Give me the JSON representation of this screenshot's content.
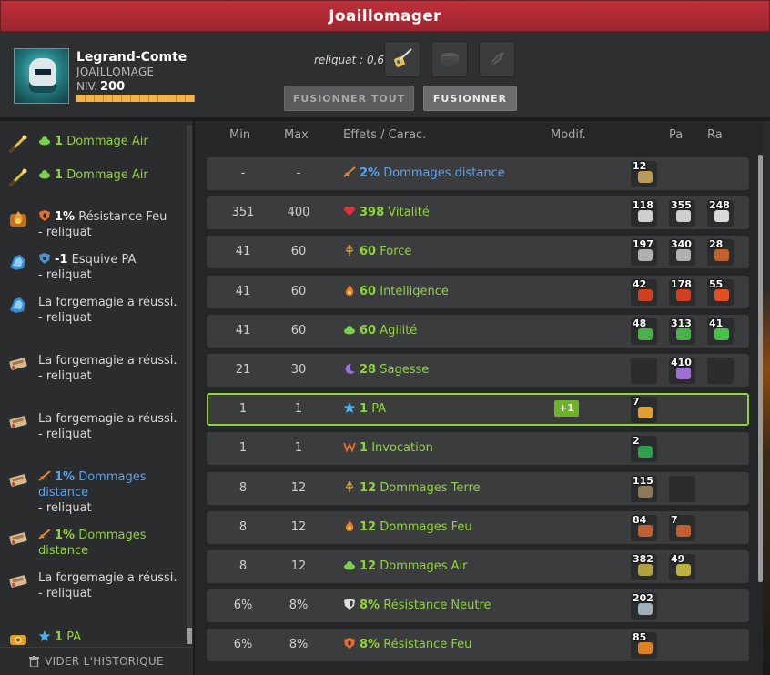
{
  "window": {
    "title": "Joaillomager"
  },
  "character": {
    "name": "Legrand-Comte",
    "job": "JOAILLOMAGE",
    "level_label": "NIV.",
    "level": "200",
    "avatar": "knight-avatar"
  },
  "reliquat": "reliquat : 0,6",
  "slots": [
    {
      "name": "rune-slot-icon",
      "filled": true
    },
    {
      "name": "item-slot-icon",
      "filled": false
    },
    {
      "name": "feather-slot-icon",
      "filled": false
    }
  ],
  "buttons": {
    "merge_all": "FUSIONNER TOUT",
    "merge": "FUSIONNER"
  },
  "history": [
    {
      "icon": "wand-icon",
      "stat_icon": "air-icon",
      "value": "1",
      "label": "Dommage Air",
      "color": "green",
      "sub": ""
    },
    {
      "icon": "wand-icon",
      "stat_icon": "air-icon",
      "value": "1",
      "label": "Dommage Air",
      "color": "green",
      "sub": ""
    },
    {
      "icon": "fire-rune-icon",
      "stat_icon": "shield-fire-icon",
      "value": "1%",
      "label": "Résistance Feu",
      "color": "white",
      "sub": "- reliquat"
    },
    {
      "icon": "blue-rune-icon",
      "stat_icon": "shield-blue-icon",
      "value": "-1",
      "label": "Esquive PA",
      "color": "white",
      "sub": "- reliquat"
    },
    {
      "icon": "blue-rune-icon",
      "stat_icon": "",
      "value": "",
      "label": "La forgemagie a réussi.",
      "color": "white",
      "sub": "- reliquat"
    },
    {
      "icon": "scroll-rune-icon",
      "stat_icon": "",
      "value": "",
      "label": "La forgemagie a réussi.",
      "color": "white",
      "sub": "- reliquat"
    },
    {
      "icon": "scroll-rune-icon",
      "stat_icon": "",
      "value": "",
      "label": "La forgemagie a réussi.",
      "color": "white",
      "sub": "- reliquat"
    },
    {
      "icon": "scroll-rune-icon",
      "stat_icon": "sword-icon",
      "value": "1%",
      "label": "Dommages distance",
      "color": "blue",
      "sub": "- reliquat"
    },
    {
      "icon": "scroll-rune-icon",
      "stat_icon": "sword-icon",
      "value": "1%",
      "label": "Dommages distance",
      "color": "green",
      "sub": ""
    },
    {
      "icon": "scroll-rune-icon",
      "stat_icon": "",
      "value": "",
      "label": "La forgemagie a réussi.",
      "color": "white",
      "sub": "- reliquat"
    },
    {
      "icon": "pa-rune-icon",
      "stat_icon": "star-icon",
      "value": "1",
      "label": "PA",
      "color": "green",
      "sub": ""
    }
  ],
  "clear_history": "VIDER L'HISTORIQUE",
  "columns": {
    "min": "Min",
    "max": "Max",
    "effects": "Effets / Carac.",
    "modif": "Modif.",
    "pa": "Pa",
    "ra": "Ra"
  },
  "rows": [
    {
      "min": "-",
      "max": "-",
      "icon": "sword-icon",
      "value": "2%",
      "label": "Dommages distance",
      "color": "blue",
      "modif": "",
      "highlight": false,
      "runes": [
        {
          "count": "12",
          "color": "#b89a5a"
        }
      ]
    },
    {
      "min": "351",
      "max": "400",
      "icon": "heart-icon",
      "value": "398",
      "label": "Vitalité",
      "color": "green",
      "modif": "",
      "highlight": false,
      "runes": [
        {
          "count": "118",
          "color": "#cfcfcf"
        },
        {
          "count": "355",
          "color": "#cfcfcf"
        },
        {
          "count": "248",
          "color": "#d9d9d9"
        }
      ]
    },
    {
      "min": "41",
      "max": "60",
      "icon": "force-icon",
      "value": "60",
      "label": "Force",
      "color": "green",
      "modif": "",
      "highlight": false,
      "runes": [
        {
          "count": "197",
          "color": "#b0b0b0"
        },
        {
          "count": "340",
          "color": "#b0b0b0"
        },
        {
          "count": "28",
          "color": "#c0602a"
        }
      ]
    },
    {
      "min": "41",
      "max": "60",
      "icon": "fire-icon",
      "value": "60",
      "label": "Intelligence",
      "color": "green",
      "modif": "",
      "highlight": false,
      "runes": [
        {
          "count": "42",
          "color": "#d04020"
        },
        {
          "count": "178",
          "color": "#d04020"
        },
        {
          "count": "55",
          "color": "#e05020"
        }
      ]
    },
    {
      "min": "41",
      "max": "60",
      "icon": "air-icon",
      "value": "60",
      "label": "Agilité",
      "color": "green",
      "modif": "",
      "highlight": false,
      "runes": [
        {
          "count": "48",
          "color": "#4ab04a"
        },
        {
          "count": "313",
          "color": "#4ab04a"
        },
        {
          "count": "41",
          "color": "#4ac04a"
        }
      ]
    },
    {
      "min": "21",
      "max": "30",
      "icon": "moon-icon",
      "value": "28",
      "label": "Sagesse",
      "color": "green",
      "modif": "",
      "highlight": false,
      "runes": [
        {
          "count": "",
          "color": ""
        },
        {
          "count": "410",
          "color": "#a070d0"
        },
        {
          "count": "",
          "color": ""
        }
      ]
    },
    {
      "min": "1",
      "max": "1",
      "icon": "star-icon",
      "value": "1",
      "label": "PA",
      "color": "green",
      "modif": "+1",
      "highlight": true,
      "runes": [
        {
          "count": "7",
          "color": "#e0a030"
        }
      ]
    },
    {
      "min": "1",
      "max": "1",
      "icon": "invocation-icon",
      "value": "1",
      "label": "Invocation",
      "color": "green",
      "modif": "",
      "highlight": false,
      "runes": [
        {
          "count": "2",
          "color": "#30a050"
        }
      ]
    },
    {
      "min": "8",
      "max": "12",
      "icon": "force-icon",
      "value": "12",
      "label": "Dommages Terre",
      "color": "green",
      "modif": "",
      "highlight": false,
      "runes": [
        {
          "count": "115",
          "color": "#8a7a5a"
        },
        {
          "count": "",
          "color": ""
        }
      ]
    },
    {
      "min": "8",
      "max": "12",
      "icon": "fire-icon",
      "value": "12",
      "label": "Dommages Feu",
      "color": "green",
      "modif": "",
      "highlight": false,
      "runes": [
        {
          "count": "84",
          "color": "#c06030"
        },
        {
          "count": "7",
          "color": "#c06030"
        }
      ]
    },
    {
      "min": "8",
      "max": "12",
      "icon": "air-icon",
      "value": "12",
      "label": "Dommages Air",
      "color": "green",
      "modif": "",
      "highlight": false,
      "runes": [
        {
          "count": "382",
          "color": "#b0a040"
        },
        {
          "count": "49",
          "color": "#c0b040"
        }
      ]
    },
    {
      "min": "6%",
      "max": "8%",
      "icon": "shield-neutral-icon",
      "value": "8%",
      "label": "Résistance Neutre",
      "color": "green",
      "modif": "",
      "highlight": false,
      "runes": [
        {
          "count": "202",
          "color": "#a0b0b8"
        }
      ]
    },
    {
      "min": "6%",
      "max": "8%",
      "icon": "shield-fire-icon",
      "value": "8%",
      "label": "Résistance Feu",
      "color": "green",
      "modif": "",
      "highlight": false,
      "runes": [
        {
          "count": "85",
          "color": "#e08020"
        }
      ]
    }
  ]
}
